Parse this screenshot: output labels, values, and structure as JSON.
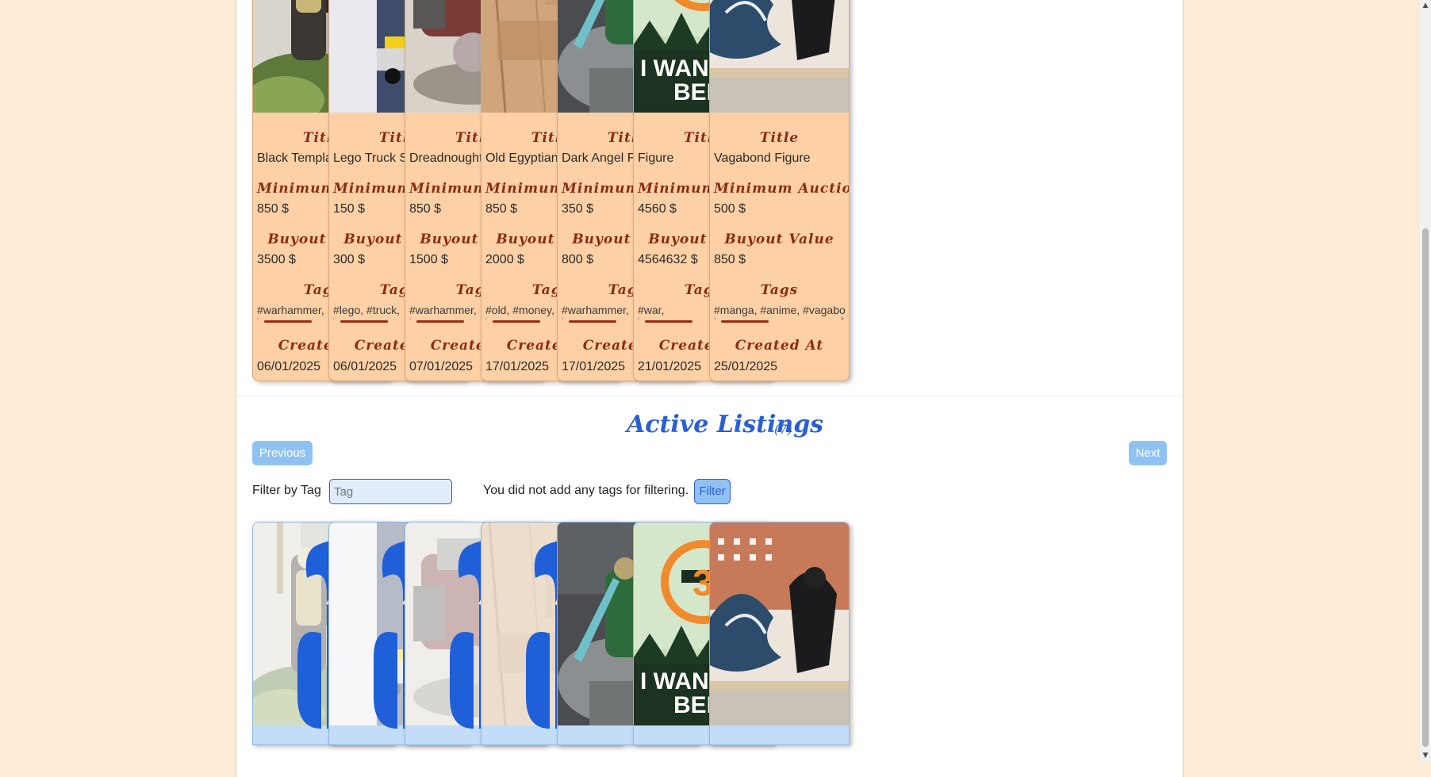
{
  "sold_listings": {
    "labels": {
      "title": "Title",
      "minimum_value": "Minimum Auction Value",
      "buyout": "Buyout Value",
      "tags": "Tags",
      "created": "Created At"
    },
    "items": [
      {
        "title": "Black Templar",
        "minimum": "850 $",
        "buyout": "3500 $",
        "tags": "#warhammer,",
        "created": "06/01/2025",
        "image": "armored-warrior-figure"
      },
      {
        "title": "Lego Truck S",
        "minimum": "150 $",
        "buyout": "300 $",
        "tags": "#lego, #truck,",
        "created": "06/01/2025",
        "image": "lego-truck-model"
      },
      {
        "title": "Dreadnought",
        "minimum": "850 $",
        "buyout": "1500 $",
        "tags": "#warhammer,",
        "created": "07/01/2025",
        "image": "dreadnought-model"
      },
      {
        "title": "Old Egyptian",
        "minimum": "850 $",
        "buyout": "2000 $",
        "tags": "#old, #money,",
        "created": "17/01/2025",
        "image": "old-parchment"
      },
      {
        "title": "Dark Angel F",
        "minimum": "350 $",
        "buyout": "800 $",
        "tags": "#warhammer,",
        "created": "17/01/2025",
        "image": "dark-angel-figure"
      },
      {
        "title": "Figure",
        "minimum": "4560 $",
        "buyout": "4564632 $",
        "tags": "#war,",
        "created": "21/01/2025",
        "image": "i-want-to-believe-poster"
      },
      {
        "title": "Vagabond Figure",
        "minimum": "500 $",
        "buyout": "850 $",
        "tags": "#manga, #anime, #vagabo",
        "created": "25/01/2025",
        "image": "vagabond-wave-figure"
      }
    ]
  },
  "active_listings": {
    "title": "Active Listings",
    "count": "(7)",
    "previous_label": "Previous",
    "next_label": "Next",
    "filter_label": "Filter by Tag",
    "tag_placeholder": "Tag",
    "no_tags_text": "You did not add any tags for filtering.",
    "filter_button": "Filter",
    "cards": [
      {
        "image": "armored-warrior-figure",
        "loading": true
      },
      {
        "image": "lego-truck-model",
        "loading": true
      },
      {
        "image": "dreadnought-model",
        "loading": true
      },
      {
        "image": "old-parchment",
        "loading": true
      },
      {
        "image": "dark-angel-figure",
        "loading": false
      },
      {
        "image": "i-want-to-believe-poster",
        "loading": false
      },
      {
        "image": "vagabond-wave-figure",
        "loading": false
      }
    ]
  },
  "poster_text": {
    "number": "3",
    "line1": "I WANT",
    "line2": "BELIE"
  },
  "colors": {
    "accent_blue": "#2a5fd3",
    "card_peach": "#fdd0a5",
    "label_red": "#8b2b14",
    "button_blue": "#8fc2f3",
    "page_bg": "#fdebd6"
  }
}
